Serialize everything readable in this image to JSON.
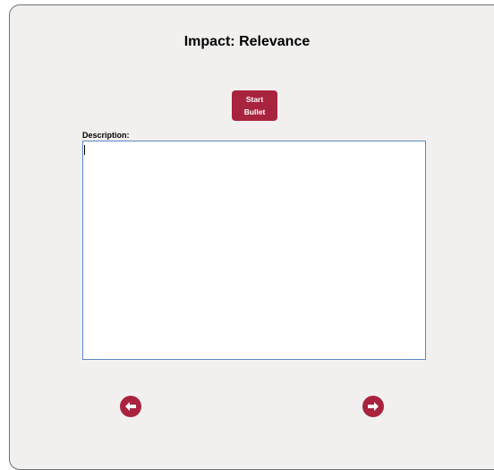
{
  "page": {
    "title": "Impact: Relevance"
  },
  "toolbar": {
    "start_bullet_line1": "Start",
    "start_bullet_line2": "Bullet"
  },
  "description": {
    "label": "Description:",
    "value": ""
  },
  "navigation": {
    "prev_icon": "arrow-left-circle-icon",
    "next_icon": "arrow-right-circle-icon"
  },
  "colors": {
    "accent": "#a8233e",
    "panel_bg": "#f2f0ef",
    "field_border": "#5a86c8"
  }
}
